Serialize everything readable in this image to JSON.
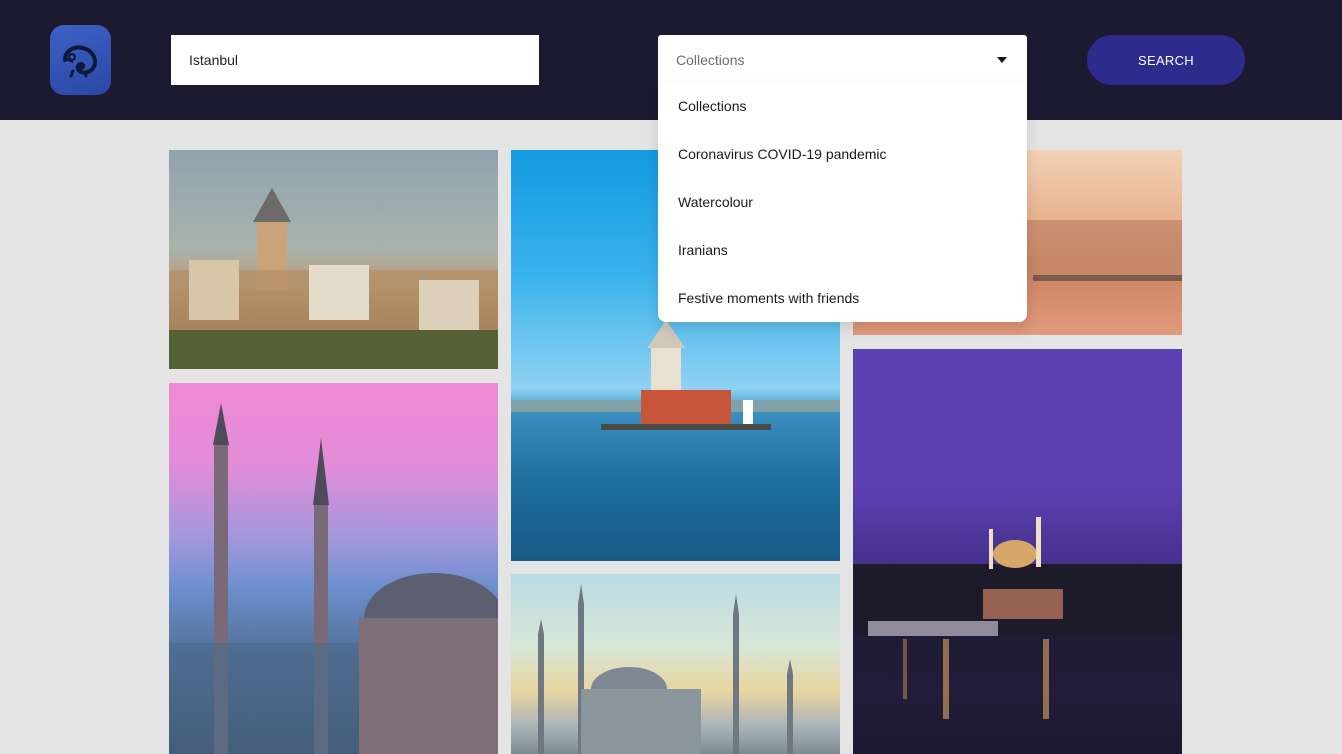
{
  "header": {
    "logo_icon": "chameleon-logo-icon",
    "search": {
      "value": "Istanbul",
      "placeholder": ""
    },
    "select": {
      "selected": "Collections",
      "caret_icon": "caret-down-icon"
    },
    "search_button_label": "SEARCH"
  },
  "dropdown": {
    "options": [
      {
        "label": "Collections"
      },
      {
        "label": "Coronavirus COVID-19 pandemic"
      },
      {
        "label": "Watercolour"
      },
      {
        "label": "Iranians"
      },
      {
        "label": "Festive moments with friends"
      }
    ]
  },
  "gallery": {
    "photos": [
      {
        "subject": "galata-tower-skyline"
      },
      {
        "subject": "maidens-tower-sea"
      },
      {
        "subject": "golden-horn-sunset"
      },
      {
        "subject": "blue-mosque-pink-sky"
      },
      {
        "subject": "mosque-dawn-sky"
      },
      {
        "subject": "night-city-purple-sky"
      }
    ]
  },
  "colors": {
    "header_bg": "#1b1a31",
    "page_bg": "#e4e4e4",
    "search_button": "#2d2c8c",
    "logo": "#2f52b4"
  }
}
